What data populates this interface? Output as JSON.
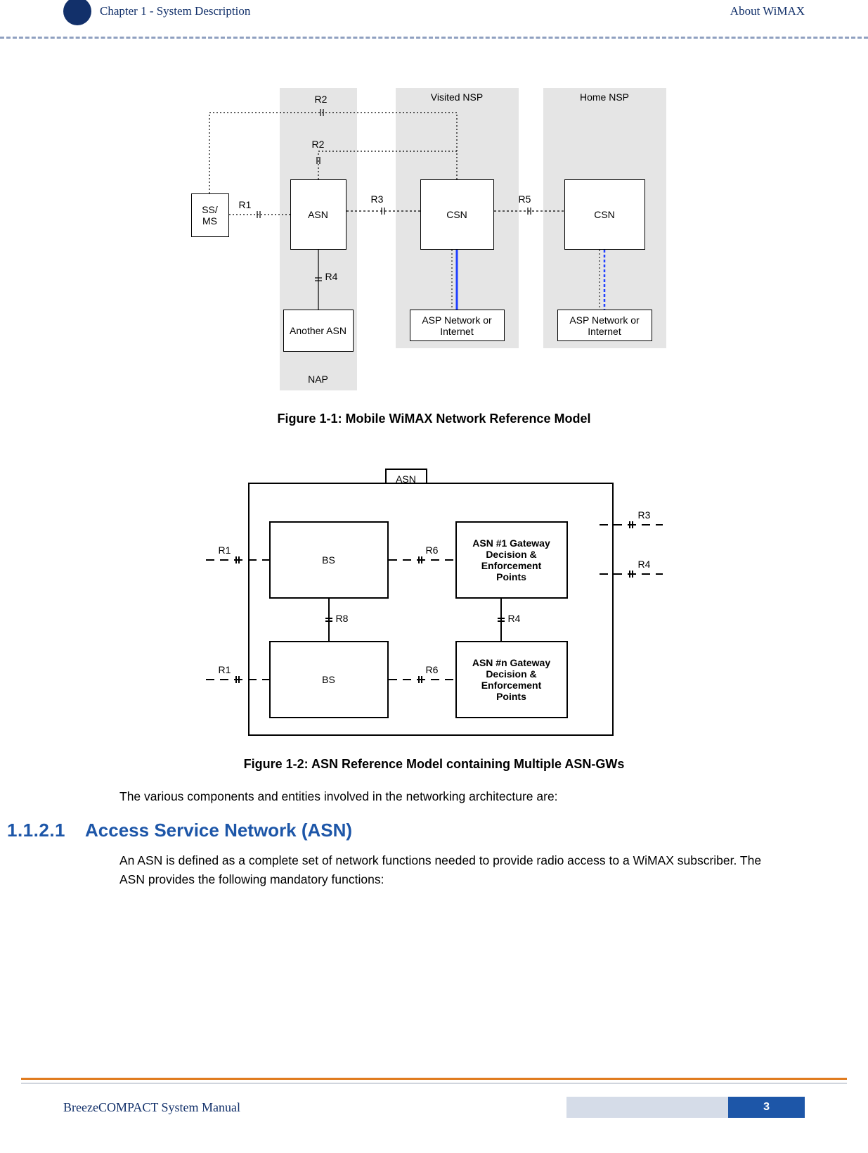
{
  "header": {
    "chapter": "Chapter 1 - System Description",
    "section": "About WiMAX"
  },
  "figure1": {
    "caption": "Figure 1-1: Mobile WiMAX Network Reference Model",
    "regions": {
      "nap": "NAP",
      "visited_nsp": "Visited NSP",
      "home_nsp": "Home NSP"
    },
    "nodes": {
      "ssms": "SS/\nMS",
      "asn": "ASN",
      "another_asn": "Another ASN",
      "csn_visited": "CSN",
      "csn_home": "CSN",
      "asp_visited": "ASP Network or\nInternet",
      "asp_home": "ASP Network  or\nInternet"
    },
    "links": {
      "r1": "R1",
      "r2_top": "R2",
      "r2_mid": "R2",
      "r3": "R3",
      "r4": "R4",
      "r5": "R5"
    }
  },
  "figure2": {
    "caption": "Figure 1-2: ASN Reference Model containing Multiple ASN-GWs",
    "asn_tab": "ASN",
    "nodes": {
      "bs1": "BS",
      "bs2": "BS",
      "gw1": "ASN #1 Gateway\nDecision &\nEnforcement\nPoints",
      "gwn": "ASN #n Gateway\nDecision &\nEnforcement\nPoints"
    },
    "links": {
      "r1a": "R1",
      "r1b": "R1",
      "r3": "R3",
      "r4_right": "R4",
      "r4_mid": "R4",
      "r6a": "R6",
      "r6b": "R6",
      "r8": "R8"
    }
  },
  "body": {
    "intro": "The various components and entities involved in the networking architecture are:",
    "section_number": "1.1.2.1",
    "section_title": "Access Service Network (ASN)",
    "section_body": "An ASN is defined as a complete set of network functions needed to provide radio access to a WiMAX subscriber. The ASN provides the following mandatory functions:"
  },
  "footer": {
    "manual": "BreezeCOMPACT System Manual",
    "page": "3"
  }
}
